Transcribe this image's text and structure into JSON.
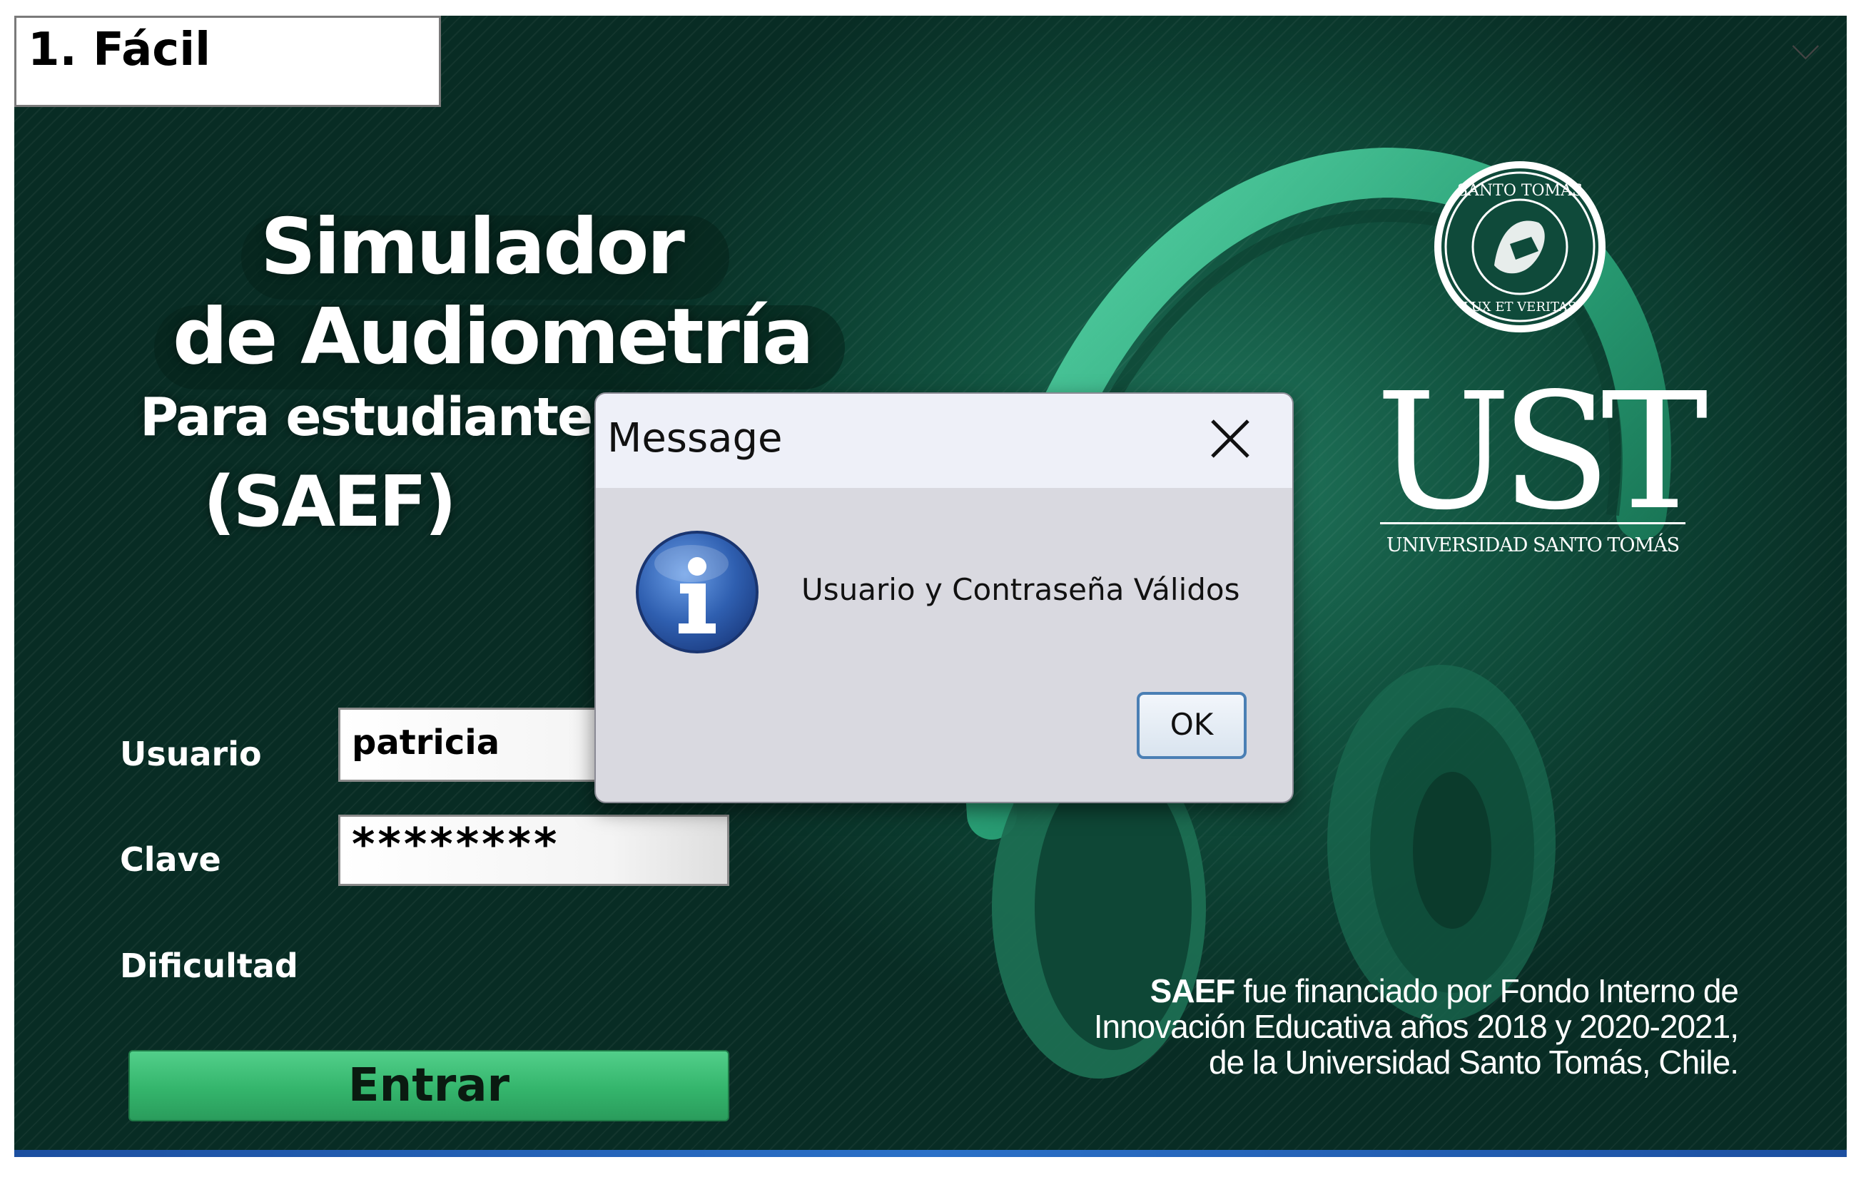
{
  "app": {
    "title_line1": "Simulador",
    "title_line2": "de Audiometría",
    "title_line3": "Para estudiantes",
    "title_line4": "(SAEF)"
  },
  "logo": {
    "seal_text_top": "SANTO TOMÁS",
    "seal_text_bottom": "LUX ET VERITAS",
    "brand": "UST",
    "brand_sub": "UNIVERSIDAD SANTO TOMÁS"
  },
  "form": {
    "user_label": "Usuario",
    "user_value": "patricia",
    "password_label": "Clave",
    "password_value": "********",
    "difficulty_label": "Dificultad",
    "difficulty_value": "1. Fácil",
    "submit_label": "Entrar"
  },
  "funding": {
    "acronym": "SAEF",
    "line1_rest": " fue financiado por Fondo Interno de",
    "line2": "Innovación Educativa años 2018 y 2020-2021,",
    "line3": "de la Universidad Santo Tomás, Chile."
  },
  "dialog": {
    "title": "Message",
    "message": "Usuario y Contraseña Válidos",
    "ok_label": "OK",
    "icon": "info-icon"
  },
  "colors": {
    "background": "#0f4a3a",
    "accent_green": "#34b56c",
    "dialog_bg": "#d9d9e0",
    "info_blue": "#2f5fb0"
  }
}
